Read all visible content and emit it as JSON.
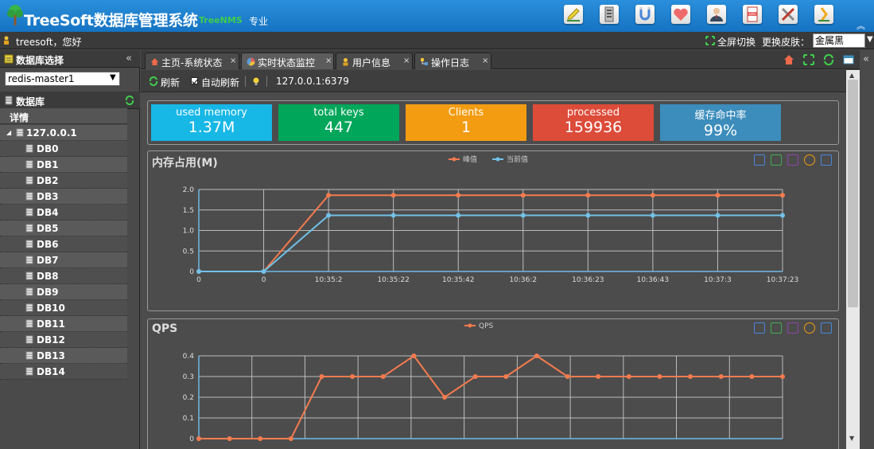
{
  "app": {
    "title": "TreeSoft数据库管理系统",
    "subtitle": "TreeNMS",
    "edition": "专业"
  },
  "header_tools": [
    {
      "icon": "edit-icon",
      "color": "#e9d13a"
    },
    {
      "icon": "server-icon",
      "color": "#d8d8d8"
    },
    {
      "icon": "magnet-icon",
      "color": "#6aa6e8"
    },
    {
      "icon": "heart-icon",
      "color": "#ee6a6a"
    },
    {
      "icon": "user-icon",
      "color": "#5b8ac9"
    },
    {
      "icon": "log-icon",
      "color": "#e55b5b"
    },
    {
      "icon": "tools-icon",
      "color": "#cfcfcf"
    },
    {
      "icon": "exit-icon",
      "color": "#f0c23a"
    }
  ],
  "userbar": {
    "greeting": "treesoft，您好",
    "fullscreen_label": "全屏切换",
    "skin_label": "更换皮肤：",
    "skin_value": "金属黑"
  },
  "left": {
    "db_select_title": "数据库选择",
    "db_select_value": "redis-master1",
    "db_title": "数据库",
    "detail_label": "详情",
    "server_node": "127.0.0.1",
    "databases": [
      "DB0",
      "DB1",
      "DB2",
      "DB3",
      "DB4",
      "DB5",
      "DB6",
      "DB7",
      "DB8",
      "DB9",
      "DB10",
      "DB11",
      "DB12",
      "DB13",
      "DB14"
    ]
  },
  "tabs": [
    {
      "label": "主页-系统状态",
      "icon": "home-icon",
      "active": false
    },
    {
      "label": "实时状态监控",
      "icon": "monitor-icon",
      "active": true
    },
    {
      "label": "用户信息",
      "icon": "user-icon",
      "active": false
    },
    {
      "label": "操作日志",
      "icon": "log-icon",
      "active": false
    }
  ],
  "toolbar": {
    "refresh_label": "刷新",
    "auto_refresh_label": "自动刷新",
    "server_address": "127.0.0.1:6379"
  },
  "stats": [
    {
      "label": "used memory",
      "value": "1.37M",
      "color": "#17b7e6"
    },
    {
      "label": "total keys",
      "value": "447",
      "color": "#00a65a"
    },
    {
      "label": "Clients",
      "value": "1",
      "color": "#f39c12"
    },
    {
      "label": "processed",
      "value": "159936",
      "color": "#dd4b39"
    },
    {
      "label": "缓存命中率",
      "value": "99%",
      "color": "#3c8dbc"
    }
  ],
  "chart_data": [
    {
      "type": "line",
      "title": "内存占用(M)",
      "categories": [
        "0",
        "0",
        "10:35:2",
        "10:35:22",
        "10:35:42",
        "10:36:2",
        "10:36:23",
        "10:36:43",
        "10:37:3",
        "10:37:23"
      ],
      "yticks": [
        "0",
        "0.5",
        "1.0",
        "1.5",
        "2.0"
      ],
      "ylim": [
        0,
        2.0
      ],
      "series": [
        {
          "name": "峰值",
          "color": "#f47b4f",
          "values": [
            0,
            0,
            1.86,
            1.86,
            1.86,
            1.86,
            1.86,
            1.86,
            1.86,
            1.86
          ]
        },
        {
          "name": "当前值",
          "color": "#71c1e8",
          "values": [
            0,
            0,
            1.37,
            1.37,
            1.37,
            1.37,
            1.37,
            1.37,
            1.37,
            1.37
          ]
        }
      ]
    },
    {
      "type": "line",
      "title": "QPS",
      "yticks": [
        "0",
        "0.1",
        "0.2",
        "0.3",
        "0.4"
      ],
      "ylim": [
        0,
        0.4
      ],
      "series": [
        {
          "name": "QPS",
          "color": "#f47b4f",
          "values": [
            0,
            0,
            0,
            0,
            0.3,
            0.3,
            0.3,
            0.4,
            0.2,
            0.3,
            0.3,
            0.4,
            0.3,
            0.3,
            0.3,
            0.3,
            0.3,
            0.3,
            0.3,
            0.3
          ]
        }
      ]
    }
  ]
}
